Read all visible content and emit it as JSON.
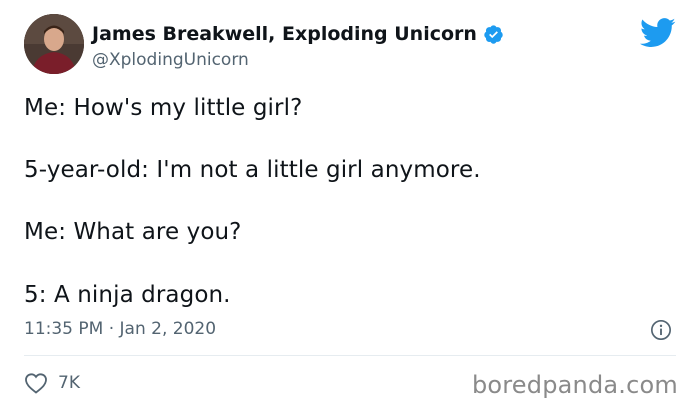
{
  "author": {
    "display_name": "James Breakwell, Exploding Unicorn",
    "handle": "@XplodingUnicorn",
    "verified": true,
    "avatar_icon": "person-avatar"
  },
  "tweet": {
    "lines": [
      "Me: How's my little girl?",
      "5-year-old: I'm not a little girl anymore.",
      "Me: What are you?",
      "5: A ninja dragon."
    ],
    "timestamp": "11:35 PM · Jan 2, 2020",
    "likes": "7K"
  },
  "watermark": "boredpanda.com",
  "colors": {
    "brand_blue": "#1d9bf0",
    "text_primary": "#0f1419",
    "text_secondary": "#536471",
    "divider": "#e6ecf0"
  },
  "icons": {
    "brand": "twitter-bird-icon",
    "verified": "verified-badge-icon",
    "info": "info-icon",
    "like": "heart-icon"
  }
}
